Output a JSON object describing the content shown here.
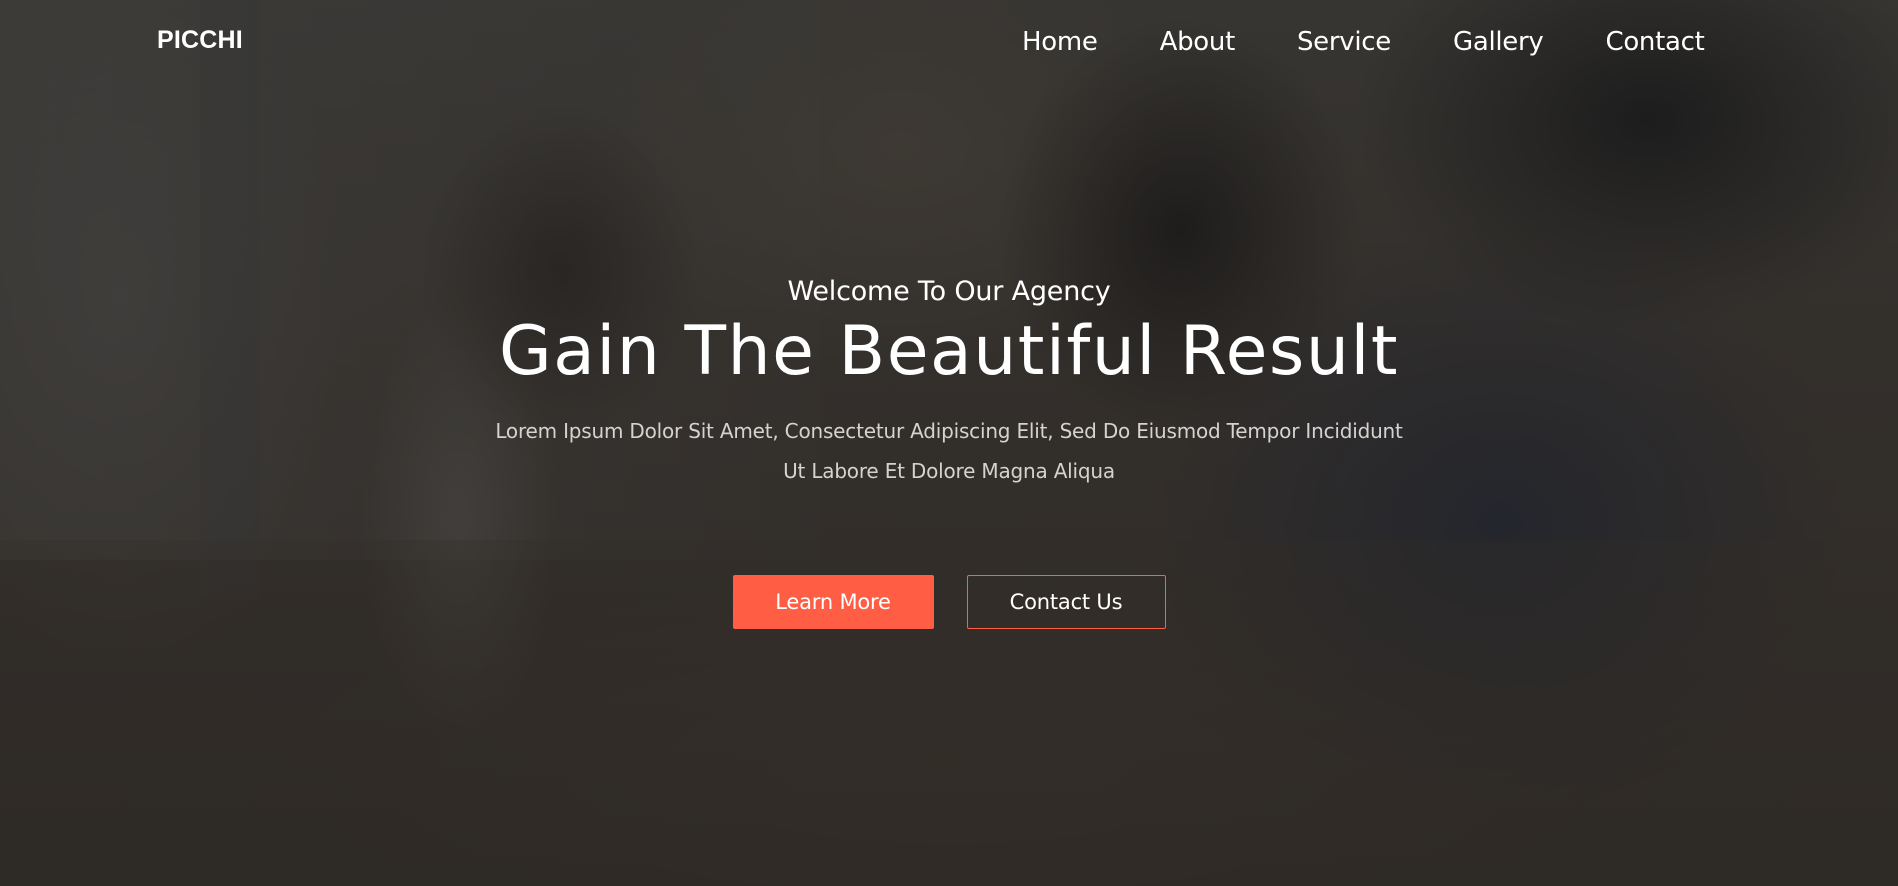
{
  "brand": {
    "logo_text": "PICCHI"
  },
  "nav": {
    "items": [
      {
        "label": "Home"
      },
      {
        "label": "About"
      },
      {
        "label": "Service"
      },
      {
        "label": "Gallery"
      },
      {
        "label": "Contact"
      }
    ]
  },
  "hero": {
    "eyebrow": "Welcome To Our Agency",
    "headline": "Gain The Beautiful Result",
    "subtext_line1": "Lorem Ipsum Dolor Sit Amet, Consectetur Adipiscing Elit, Sed Do Eiusmod Tempor Incididunt",
    "subtext_line2": "Ut Labore Et Dolore Magna Aliqua",
    "primary_button": "Learn More",
    "secondary_button": "Contact Us"
  },
  "colors": {
    "accent": "#ff5e45",
    "text": "#ffffff",
    "muted_text": "#d5d2cf",
    "overlay": "#1e1e1e"
  }
}
